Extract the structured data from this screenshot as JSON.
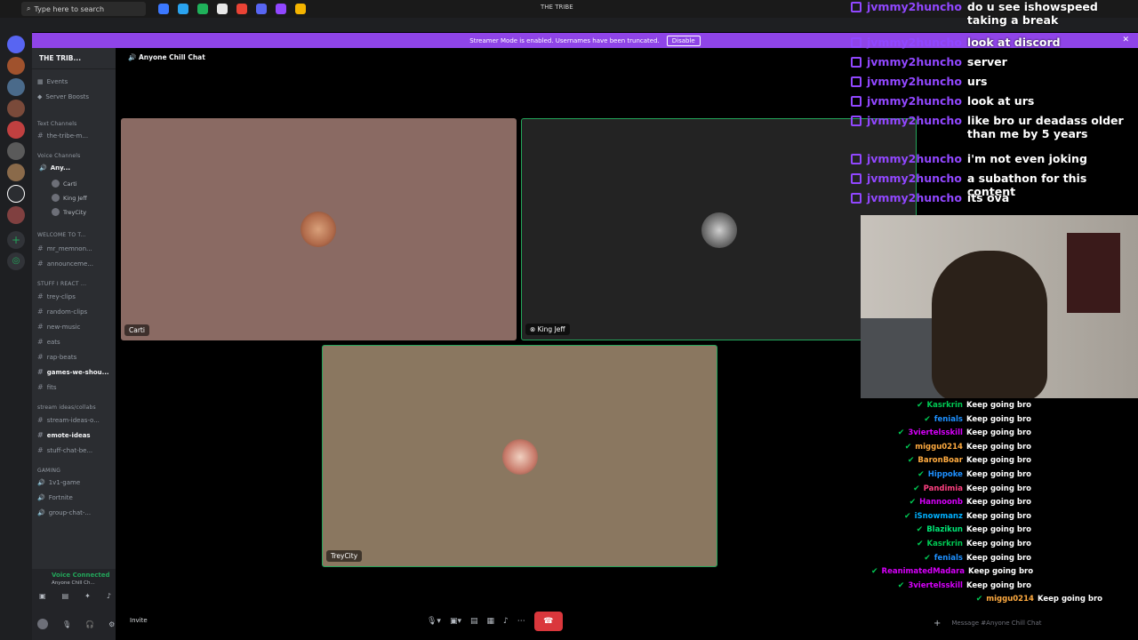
{
  "taskbar": {
    "search_placeholder": "Type here to search",
    "window_title": "THE TRIBE"
  },
  "banner": {
    "text": "Streamer Mode is enabled. Usernames have been truncated.",
    "button": "Disable"
  },
  "sidebar": {
    "server_name": "THE TRIB...",
    "events": "Events",
    "boosts": "Server Boosts",
    "categories": {
      "text": "Text Channels",
      "voice": "Voice Channels",
      "welcome": "WELCOME TO T...",
      "stuff": "STUFF I REACT ...",
      "stream": "stream ideas/collabs",
      "gaming": "GAMING"
    },
    "channels": {
      "tribe": "the-tribe-m...",
      "anyone": "Any...",
      "mr": "mr_memnon...",
      "announce": "announceme...",
      "trey_clips": "trey-clips",
      "random_clips": "random-clips",
      "new_music": "new-music",
      "eats": "eats",
      "rap_beats": "rap-beats",
      "games": "games-we-shou...",
      "fits": "fits",
      "stream_ideas": "stream-ideas-o...",
      "emote": "emote-ideas",
      "stuff_chat": "stuff-chat-be...",
      "one_v_one": "1v1-game",
      "fortnite": "Fortnite",
      "group_chat": "group-chat-..."
    },
    "voice_users": [
      "Carti",
      "King Jeff",
      "TreyCity"
    ],
    "voice_connected": "Voice Connected",
    "voice_channel": "Anyone Chill Ch..."
  },
  "main": {
    "channel_header": "Anyone Chill Chat",
    "tiles": [
      {
        "name": "Carti"
      },
      {
        "name": "King Jeff"
      },
      {
        "name": "TreyCity"
      }
    ],
    "invite": "Invite"
  },
  "overlay_chat": [
    {
      "user": "jvmmy2huncho",
      "msg": "do u see ishowspeed taking a break"
    },
    {
      "user": "jvmmy2huncho",
      "msg": "look at discord"
    },
    {
      "user": "jvmmy2huncho",
      "msg": "server"
    },
    {
      "user": "jvmmy2huncho",
      "msg": "urs"
    },
    {
      "user": "jvmmy2huncho",
      "msg": "look at urs"
    },
    {
      "user": "jvmmy2huncho",
      "msg": "like bro ur deadass older than me by 5 years"
    },
    {
      "user": "jvmmy2huncho",
      "msg": "i'm not even joking"
    },
    {
      "user": "jvmmy2huncho",
      "msg": "a subathon for this content"
    },
    {
      "user": "jvmmy2huncho",
      "msg": "its ova"
    }
  ],
  "bottom_chat": [
    {
      "user": "Kasrkrin",
      "msg": "Keep going bro",
      "color": "#00c853"
    },
    {
      "user": "fenials",
      "msg": "Keep going bro",
      "color": "#1e90ff"
    },
    {
      "user": "3viertelsskill",
      "msg": "Keep going bro",
      "color": "#d500f9"
    },
    {
      "user": "miggu0214",
      "msg": "Keep going bro",
      "color": "#ffab40"
    },
    {
      "user": "BaronBoar",
      "msg": "Keep going bro",
      "color": "#ffab40"
    },
    {
      "user": "Hippoke",
      "msg": "Keep going bro",
      "color": "#1e90ff"
    },
    {
      "user": "Pandimia",
      "msg": "Keep going bro",
      "color": "#ff4081"
    },
    {
      "user": "Hannoonb",
      "msg": "Keep going bro",
      "color": "#d500f9"
    },
    {
      "user": "iSnowmanz",
      "msg": "Keep going bro",
      "color": "#00b0ff"
    },
    {
      "user": "Blazikun",
      "msg": "Keep going bro",
      "color": "#00e676"
    },
    {
      "user": "Kasrkrin",
      "msg": "Keep going bro",
      "color": "#00c853"
    },
    {
      "user": "fenials",
      "msg": "Keep going bro",
      "color": "#1e90ff"
    },
    {
      "user": "ReanimatedMadara",
      "msg": "Keep going bro",
      "color": "#d500f9"
    },
    {
      "user": "3viertelsskill",
      "msg": "Keep going bro",
      "color": "#d500f9"
    },
    {
      "user": "miggu0214",
      "msg": "Keep going bro",
      "color": "#ffab40"
    }
  ],
  "chat_input_placeholder": "Message #Anyone Chill Chat",
  "colors": {
    "accent": "#8f44e8",
    "twitch": "#9147ff",
    "hangup": "#da373c"
  }
}
